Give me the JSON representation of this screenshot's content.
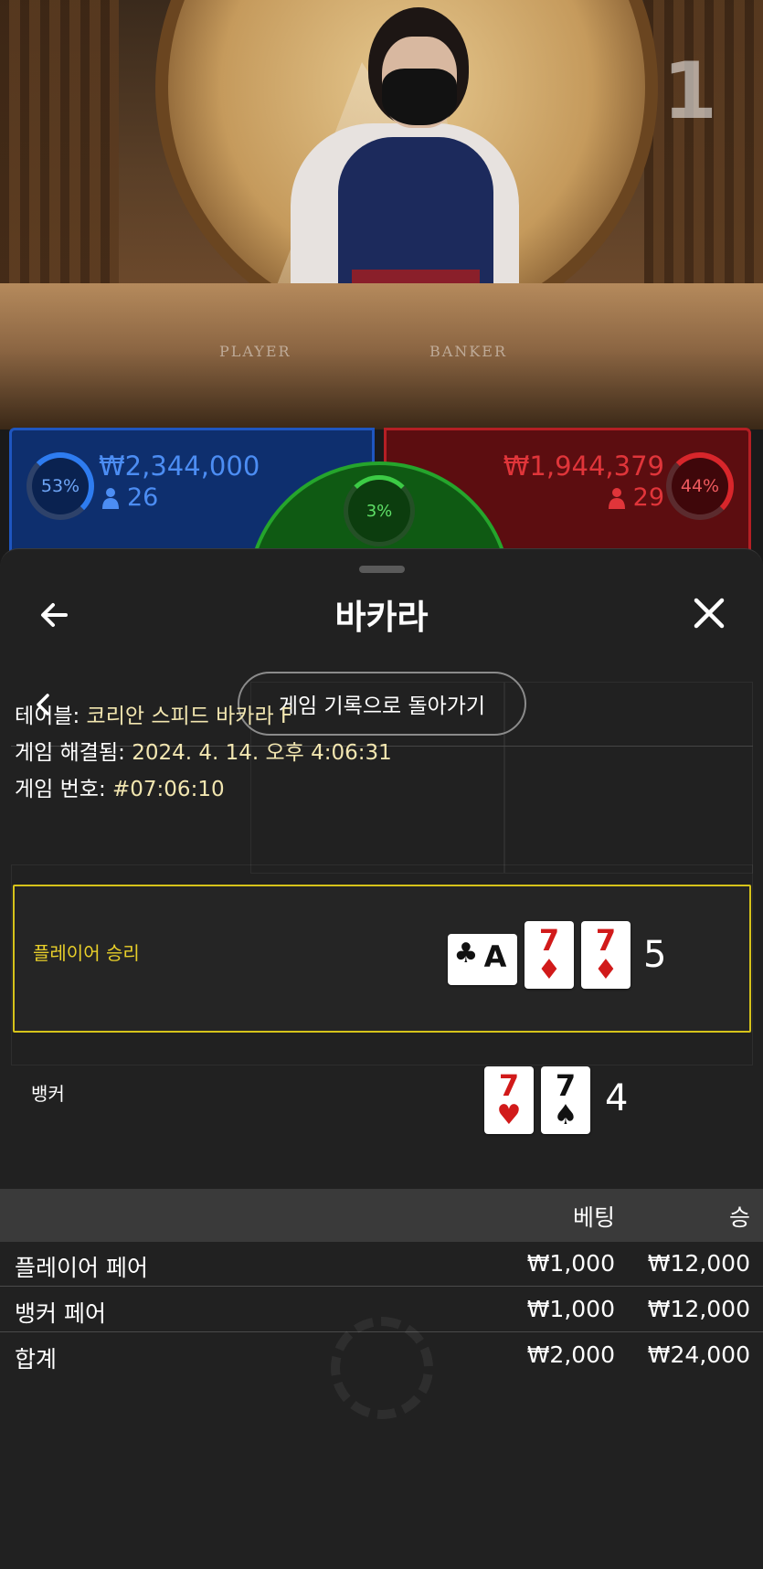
{
  "stream": {
    "round_number": "1",
    "table_labels": [
      "PLAYER",
      "BANKER"
    ]
  },
  "stats": {
    "player": {
      "percent": "53%",
      "amount": "₩2,344,000",
      "count": "26"
    },
    "banker": {
      "percent": "44%",
      "amount": "₩1,944,379",
      "count": "29"
    },
    "tie": {
      "percent": "3%"
    }
  },
  "sheet": {
    "title": "바카라",
    "back_to_history": "게임 기록으로 돌아가기"
  },
  "info": {
    "table_label": "테이블:",
    "table_value": "코리안 스피드 바카라 F",
    "resolved_label": "게임 해결됨:",
    "resolved_value": "2024. 4. 14. 오후 4:06:31",
    "game_no_label": "게임 번호:",
    "game_no_value": "#07:06:10"
  },
  "player_hand": {
    "label": "플레이어 승리",
    "score": "5",
    "cards": [
      {
        "rank": "A",
        "suit": "♣",
        "color": "black",
        "sideways": true
      },
      {
        "rank": "7",
        "suit": "♦",
        "color": "red"
      },
      {
        "rank": "7",
        "suit": "♦",
        "color": "red"
      }
    ]
  },
  "banker_hand": {
    "label": "뱅커",
    "score": "4",
    "cards": [
      {
        "rank": "7",
        "suit": "♥",
        "color": "red"
      },
      {
        "rank": "7",
        "suit": "♠",
        "color": "black"
      }
    ]
  },
  "bets_table": {
    "headers": {
      "bet": "베팅",
      "win": "승"
    },
    "rows": [
      {
        "name": "플레이어 페어",
        "bet": "₩1,000",
        "win": "₩12,000"
      },
      {
        "name": "뱅커 페어",
        "bet": "₩1,000",
        "win": "₩12,000"
      }
    ],
    "total": {
      "name": "합계",
      "bet": "₩2,000",
      "win": "₩24,000"
    }
  },
  "colors": {
    "player_blue": "#1f56c0",
    "banker_red": "#b51f24",
    "tie_green": "#25a52c",
    "win_highlight": "#d6c31a"
  }
}
